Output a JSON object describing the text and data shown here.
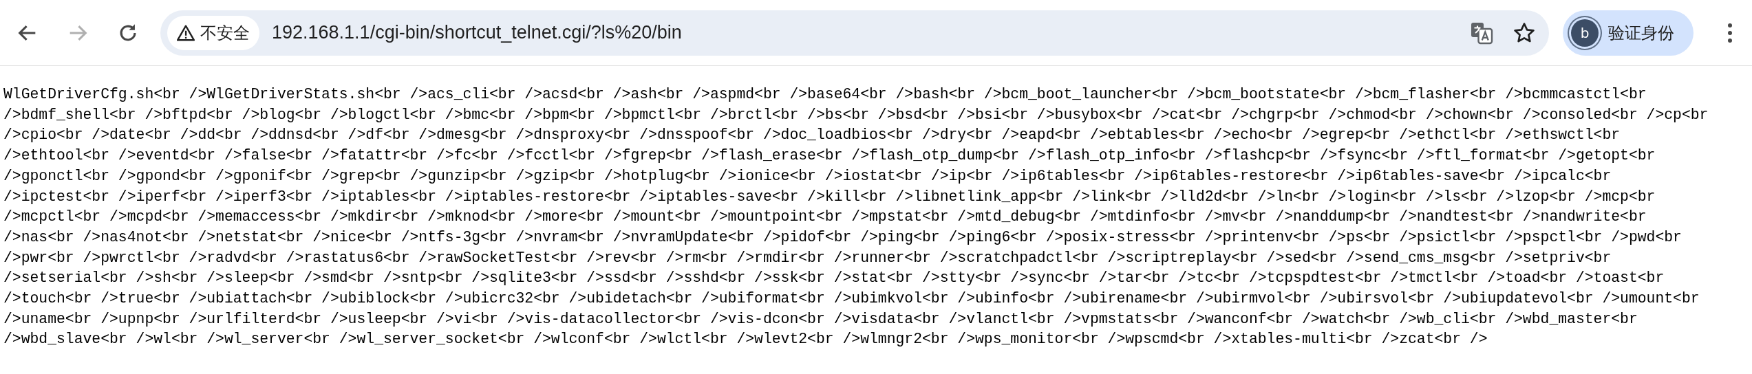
{
  "toolbar": {
    "nav": [
      {
        "kind": "back",
        "disabled": false
      },
      {
        "kind": "forward",
        "disabled": true
      },
      {
        "kind": "reload",
        "disabled": false
      }
    ],
    "security_chip": "不安全",
    "url": "192.168.1.1/cgi-bin/shortcut_telnet.cgi/?ls%20/bin",
    "profile": {
      "avatar": "b",
      "label": "验证身份"
    }
  },
  "page": {
    "lines": [
      "WlGetDriverCfg.sh<br />WlGetDriverStats.sh<br />acs_cli<br />acsd<br />ash<br />aspmd<br />base64<br />bash<br />bcm_boot_launcher<br />bcm_bootstate<br />bcm_flasher<br />bcmmcastctl<br",
      "/>bdmf_shell<br />bftpd<br />blog<br />blogctl<br />bmc<br />bpm<br />bpmctl<br />brctl<br />bs<br />bsd<br />bsi<br />busybox<br />cat<br />chgrp<br />chmod<br />chown<br />consoled<br />cp<br",
      "/>cpio<br />date<br />dd<br />ddnsd<br />df<br />dmesg<br />dnsproxy<br />dnsspoof<br />doc_loadbios<br />dry<br />eapd<br />ebtables<br />echo<br />egrep<br />ethctl<br />ethswctl<br",
      "/>ethtool<br />eventd<br />false<br />fatattr<br />fc<br />fcctl<br />fgrep<br />flash_erase<br />flash_otp_dump<br />flash_otp_info<br />flashcp<br />fsync<br />ftl_format<br />getopt<br",
      "/>gponctl<br />gpond<br />gponif<br />grep<br />gunzip<br />gzip<br />hotplug<br />ionice<br />iostat<br />ip<br />ip6tables<br />ip6tables-restore<br />ip6tables-save<br />ipcalc<br",
      "/>ipctest<br />iperf<br />iperf3<br />iptables<br />iptables-restore<br />iptables-save<br />kill<br />libnetlink_app<br />link<br />lld2d<br />ln<br />login<br />ls<br />lzop<br />mcp<br",
      "/>mcpctl<br />mcpd<br />memaccess<br />mkdir<br />mknod<br />more<br />mount<br />mountpoint<br />mpstat<br />mtd_debug<br />mtdinfo<br />mv<br />nanddump<br />nandtest<br />nandwrite<br",
      "/>nas<br />nas4not<br />netstat<br />nice<br />ntfs-3g<br />nvram<br />nvramUpdate<br />pidof<br />ping<br />ping6<br />posix-stress<br />printenv<br />ps<br />psictl<br />pspctl<br />pwd<br",
      "/>pwr<br />pwrctl<br />radvd<br />rastatus6<br />rawSocketTest<br />rev<br />rm<br />rmdir<br />runner<br />scratchpadctl<br />scriptreplay<br />sed<br />send_cms_msg<br />setpriv<br",
      "/>setserial<br />sh<br />sleep<br />smd<br />sntp<br />sqlite3<br />ssd<br />sshd<br />ssk<br />stat<br />stty<br />sync<br />tar<br />tc<br />tcpspdtest<br />tmctl<br />toad<br />toast<br",
      "/>touch<br />true<br />ubiattach<br />ubiblock<br />ubicrc32<br />ubidetach<br />ubiformat<br />ubimkvol<br />ubinfo<br />ubirename<br />ubirmvol<br />ubirsvol<br />ubiupdatevol<br />umount<br",
      "/>uname<br />upnp<br />urlfilterd<br />usleep<br />vi<br />vis-datacollector<br />vis-dcon<br />visdata<br />vlanctl<br />vpmstats<br />wanconf<br />watch<br />wb_cli<br />wbd_master<br",
      "/>wbd_slave<br />wl<br />wl_server<br />wl_server_socket<br />wlconf<br />wlctl<br />wlevt2<br />wlmngr2<br />wps_monitor<br />wpscmd<br />xtables-multi<br />zcat<br />"
    ]
  }
}
